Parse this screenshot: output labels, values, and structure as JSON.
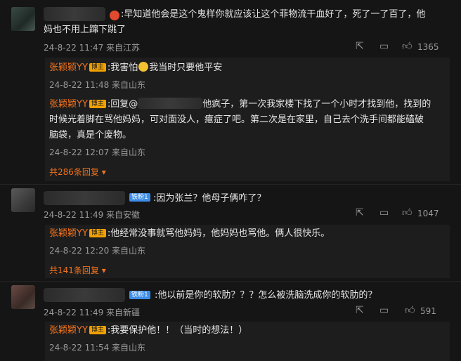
{
  "badges": {
    "blogger": "博主",
    "verify": "铁粉1"
  },
  "comments": [
    {
      "text_line1": ":早知道他会是这个鬼样你就应该让这个菲物流干血好了，死了一了百了，他",
      "text_line2": "妈也不用上蹿下跳了",
      "meta": "24-8-22 11:47 来自江苏",
      "likes": "1365",
      "replies": [
        {
          "name": "张颖颖YY",
          "text_a": ":我害怕",
          "text_b": "我当时只要他平安",
          "meta": "24-8-22 11:48 来自山东"
        },
        {
          "name": "张颖颖YY",
          "prefix": ":回复@",
          "line1": "他疯子，第一次我家楼下找了一个小时才找到他，找到的",
          "line2": "时候光着脚在骂他妈妈，可对面没人，癔症了吧。第二次是在家里，自己去个洗手间都能磕破",
          "line3": "脑袋，真是个废物。",
          "meta": "24-8-22 12:07 来自山东"
        }
      ],
      "more": "共286条回复"
    },
    {
      "text": ":因为张兰？他母子俩咋了？",
      "meta": "24-8-22 11:49 来自安徽",
      "likes": "1047",
      "replies": [
        {
          "name": "张颖颖YY",
          "text": ":他经常没事就骂他妈妈，他妈妈也骂他。俩人很快乐。",
          "meta": "24-8-22 12:20 来自山东"
        }
      ],
      "more": "共141条回复"
    },
    {
      "text": ":他以前是你的软肋？？？怎么被洗脑洗成你的软肋的？",
      "meta": "24-8-22 11:49 来自新疆",
      "likes": "591",
      "replies": [
        {
          "name": "张颖颖YY",
          "text": ":我要保护他！！（当时的想法！）",
          "meta": "24-8-22 11:54 来自山东"
        }
      ]
    }
  ]
}
